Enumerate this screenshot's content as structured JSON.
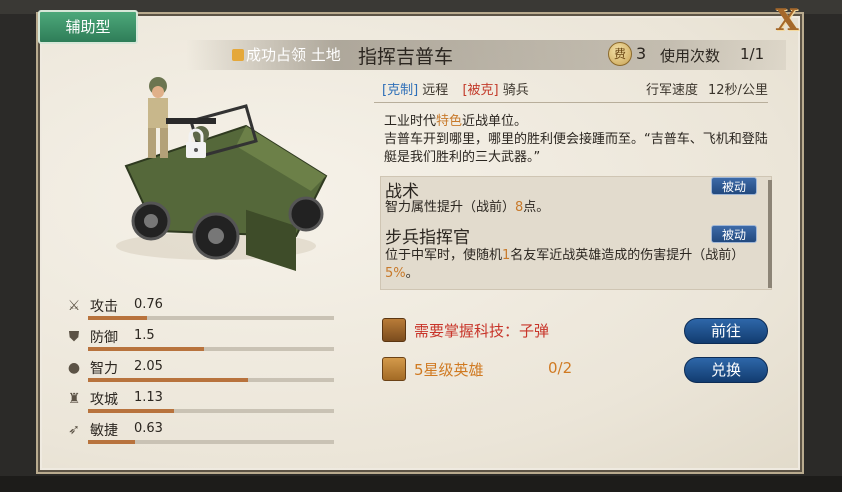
{
  "type_tab": "辅助型",
  "close_label": "X",
  "notice": "成功占领 土地",
  "unit_name": "指挥吉普车",
  "cost_icon_text": "费",
  "cost": "3",
  "uses_label": "使用次数",
  "uses_value": "1/1",
  "counters": {
    "counter_tag": "[克制]",
    "counter_value": "远程",
    "countered_tag": "[被克]",
    "countered_value": "骑兵"
  },
  "speed": {
    "label": "行军速度",
    "value": "12秒/公里"
  },
  "description": {
    "line1_pre": "工业时代",
    "line1_hl": "特色",
    "line1_post": "近战单位。",
    "line2": "吉普车开到哪里，哪里的胜利便会接踵而至。“吉普车、飞机和登陆艇是我们胜利的三大武器。”"
  },
  "skills": [
    {
      "title": "战术",
      "badge": "被动",
      "desc_pre": "智力属性提升（战前）",
      "desc_num": "8",
      "desc_post": "点。"
    },
    {
      "title": "步兵指挥官",
      "badge": "被动",
      "desc_pre": "位于中军时，使随机",
      "desc_num": "1",
      "desc_mid": "名友军近战英雄造成的伤害提升（战前）",
      "desc_num2": "5%",
      "desc_post": "。"
    }
  ],
  "requirements": [
    {
      "text": "需要掌握科技：子弹",
      "button": "前往"
    },
    {
      "text": "5星级英雄",
      "progress": "0/2",
      "button": "兑换"
    }
  ],
  "stats": [
    {
      "label": "攻击",
      "value": "0.76",
      "fill": 0.24,
      "icon": "sword-icon"
    },
    {
      "label": "防御",
      "value": "1.5",
      "fill": 0.47,
      "icon": "shield-icon"
    },
    {
      "label": "智力",
      "value": "2.05",
      "fill": 0.65,
      "icon": "brain-icon"
    },
    {
      "label": "攻城",
      "value": "1.13",
      "fill": 0.35,
      "icon": "castle-icon"
    },
    {
      "label": "敏捷",
      "value": "0.63",
      "fill": 0.19,
      "icon": "wing-icon"
    }
  ],
  "colors": {
    "accent_green": "#3f9468",
    "highlight": "#c87a2b",
    "button_blue": "#1f4f8a",
    "bar_fill": "#b8733d",
    "red_text": "#c8352a"
  }
}
